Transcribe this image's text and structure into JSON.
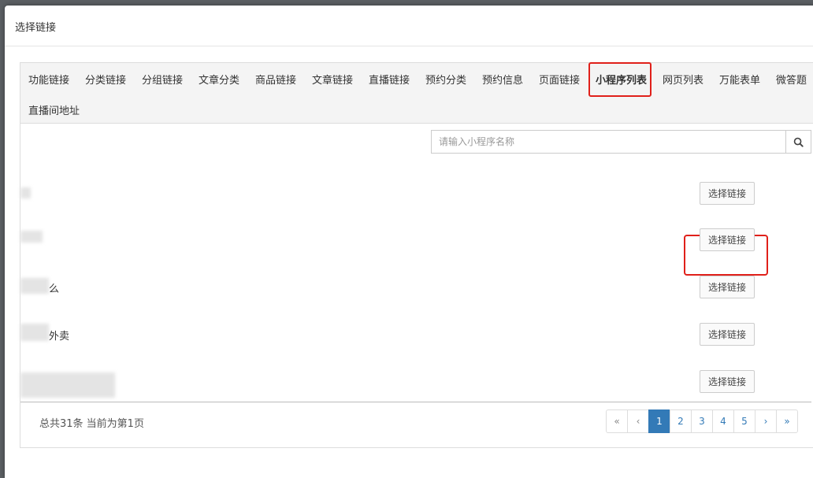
{
  "modal": {
    "title": "选择链接"
  },
  "tabs": [
    {
      "label": "功能链接"
    },
    {
      "label": "分类链接"
    },
    {
      "label": "分组链接"
    },
    {
      "label": "文章分类"
    },
    {
      "label": "商品链接"
    },
    {
      "label": "文章链接"
    },
    {
      "label": "直播链接"
    },
    {
      "label": "预约分类"
    },
    {
      "label": "预约信息"
    },
    {
      "label": "页面链接"
    },
    {
      "label": "小程序列表",
      "active": true
    },
    {
      "label": "网页列表"
    },
    {
      "label": "万能表单"
    },
    {
      "label": "微答题"
    },
    {
      "label": "直播间地址"
    }
  ],
  "search": {
    "placeholder": "请输入小程序名称",
    "icon": "search-icon"
  },
  "rows": [
    {
      "name": "",
      "button": "选择链接"
    },
    {
      "name": "",
      "button": "选择链接"
    },
    {
      "name": "么",
      "button": "选择链接"
    },
    {
      "name": "外卖",
      "button": "选择链接"
    },
    {
      "name": "",
      "button": "选择链接"
    }
  ],
  "summary": "总共31条 当前为第1页",
  "pagination": {
    "first": "«",
    "prev": "‹",
    "pages": [
      "1",
      "2",
      "3",
      "4",
      "5"
    ],
    "current": "1",
    "next": "›",
    "last": "»"
  },
  "colors": {
    "highlight": "#e0201a",
    "pager_active": "#337ab7"
  }
}
